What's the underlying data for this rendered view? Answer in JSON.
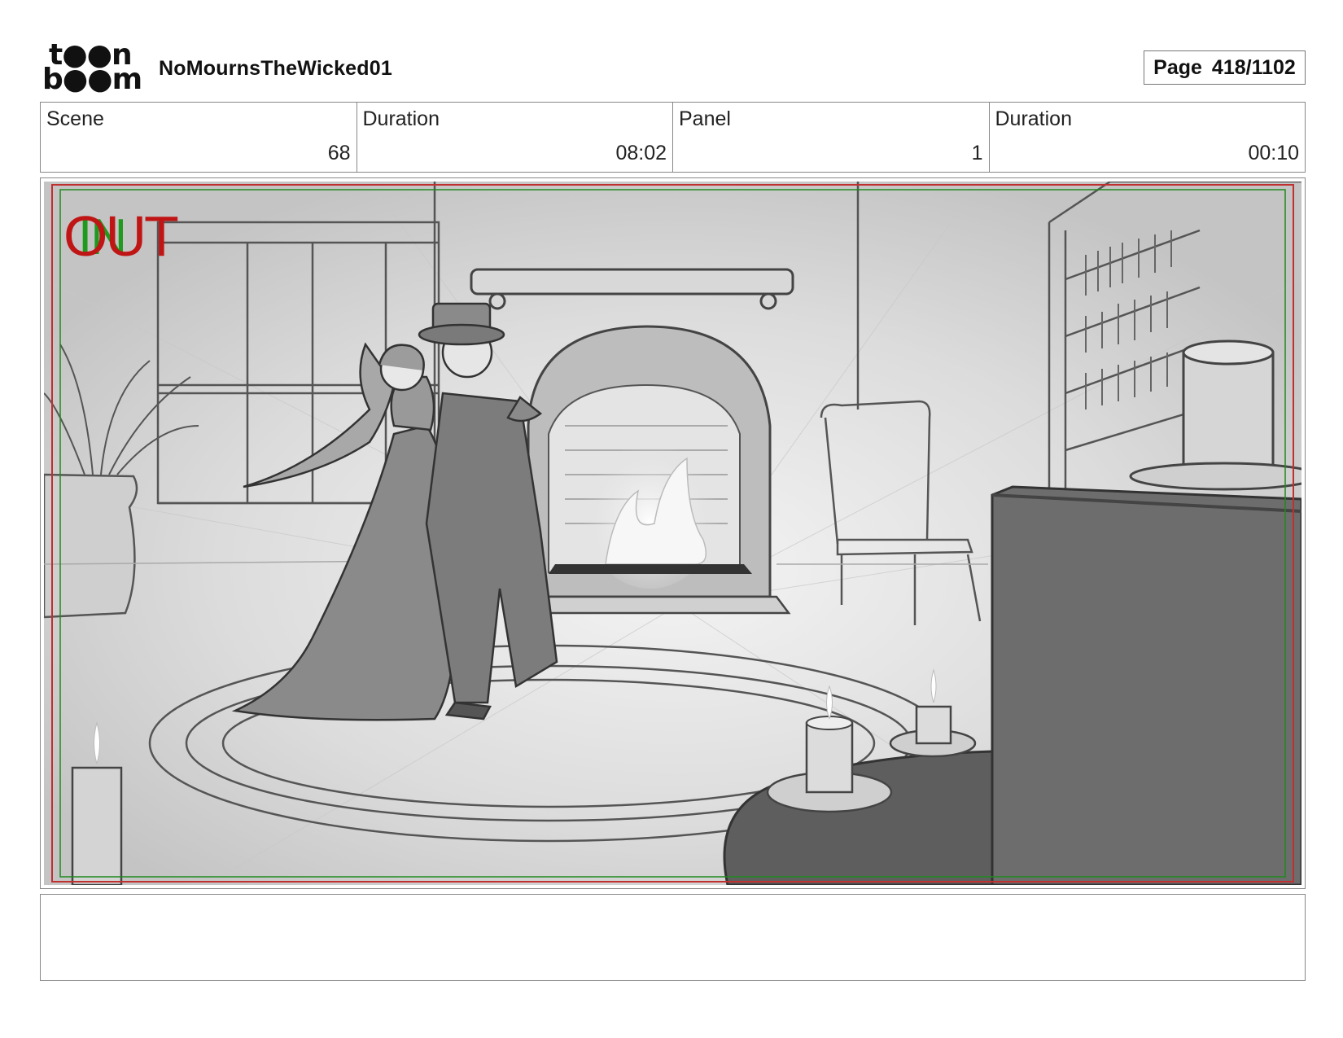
{
  "header": {
    "logo_line1": "t●●n",
    "logo_line2": "b●●m",
    "project_title": "NoMournsTheWicked01",
    "page_label": "Page",
    "page_value": "418/1102"
  },
  "info": {
    "scene_label": "Scene",
    "scene_value": "68",
    "scene_duration_label": "Duration",
    "scene_duration_value": "08:02",
    "panel_label": "Panel",
    "panel_value": "1",
    "panel_duration_label": "Duration",
    "panel_duration_value": "00:10"
  },
  "panel": {
    "in_marker": "IN",
    "out_marker": "OUT",
    "in_color": "#1f9a1f",
    "out_color": "#c01515"
  },
  "notes": {
    "text": ""
  }
}
